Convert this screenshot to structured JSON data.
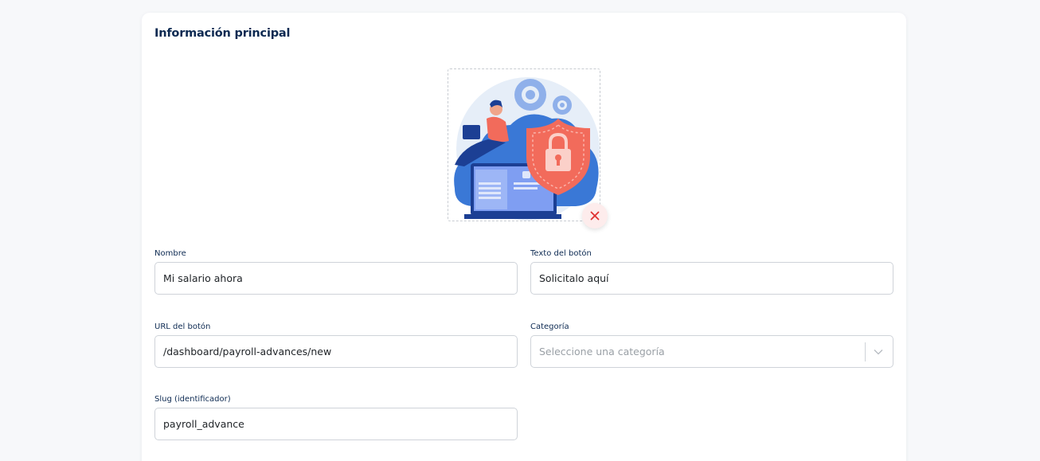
{
  "section": {
    "title": "Información principal"
  },
  "image": {
    "alt_icon": "security-cloud-illustration",
    "remove_icon": "close-icon"
  },
  "fields": {
    "nombre": {
      "label": "Nombre",
      "value": "Mi salario ahora"
    },
    "texto_boton": {
      "label": "Texto del botón",
      "value": "Solicitalo aquí"
    },
    "url_boton": {
      "label": "URL del botón",
      "value": "/dashboard/payroll-advances/new"
    },
    "categoria": {
      "label": "Categoría",
      "placeholder": "Seleccione una categoría"
    },
    "slug": {
      "label": "Slug (identificador)",
      "value": "payroll_advance"
    }
  },
  "colors": {
    "title": "#0d2a52",
    "remove_accent": "#e03131",
    "shield": "#f26b5b",
    "cloud": "#3a78d6"
  }
}
